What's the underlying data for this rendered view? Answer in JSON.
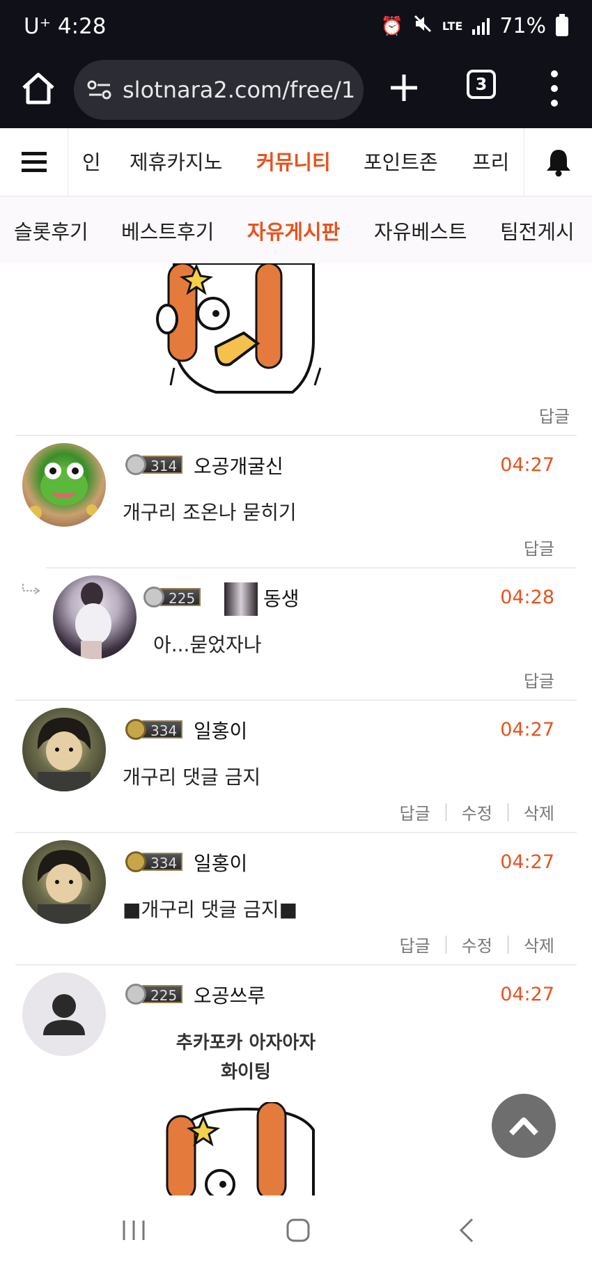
{
  "status": {
    "carrier_time": "U⁺ 4:28",
    "network": "LTE",
    "battery": "71%"
  },
  "browser": {
    "url": "slotnara2.com/free/1",
    "tab_count": "3"
  },
  "main_nav": {
    "items": [
      "인",
      "제휴카지노",
      "커뮤니티",
      "포인트존",
      "프리"
    ],
    "active": "커뮤니티"
  },
  "sub_nav": {
    "items": [
      "슬롯후기",
      "베스트후기",
      "자유게시판",
      "자유베스트",
      "팀전게시"
    ],
    "active": "자유게시판"
  },
  "top_block": {
    "reply_label": "답글"
  },
  "comments": [
    {
      "level": "314",
      "nickname": "오공개굴신",
      "time": "04:27",
      "text": "개구리 조온나  묻히기",
      "reply": "답글"
    },
    {
      "level": "225",
      "nickname": "동생",
      "time": "04:28",
      "text": "아...묻었자나",
      "reply": "답글"
    },
    {
      "level": "334",
      "nickname": "일홍이",
      "time": "04:27",
      "text": "개구리 댓글 금지",
      "reply": "답글",
      "edit": "수정",
      "delete": "삭제"
    },
    {
      "level": "334",
      "nickname": "일홍이",
      "time": "04:27",
      "text": "■개구리 댓글 금지■",
      "reply": "답글",
      "edit": "수정",
      "delete": "삭제"
    },
    {
      "level": "225",
      "nickname": "오공쓰루",
      "time": "04:27",
      "sticker_line1": "추카포카 아자아자",
      "sticker_line2": "화이팅"
    }
  ],
  "colors": {
    "accent": "#e8521d",
    "dark_bar": "#101019",
    "url_box": "#2b2c34",
    "fab": "#6e6e6e"
  },
  "icons": [
    "home-icon",
    "site-settings-icon",
    "plus-icon",
    "tabs-icon",
    "more-icon",
    "menu-icon",
    "bell-icon",
    "chevron-up-icon",
    "recent-apps-icon",
    "home-nav-icon",
    "back-icon"
  ]
}
